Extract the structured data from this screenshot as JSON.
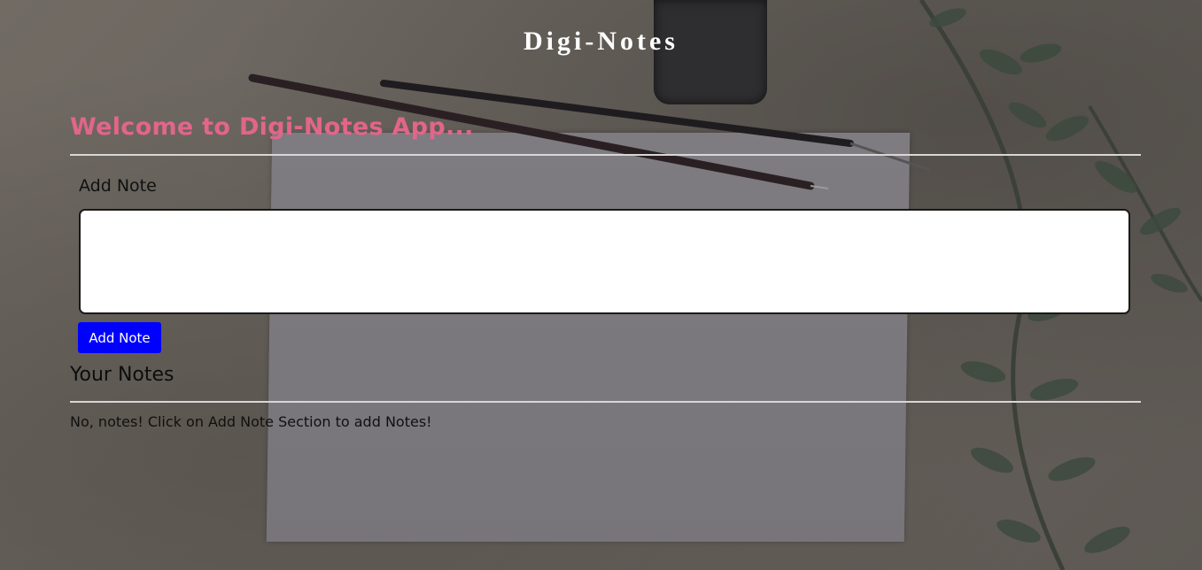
{
  "header": {
    "app_title": "Digi-Notes"
  },
  "main": {
    "welcome_text": "Welcome to Digi-Notes App...",
    "add_section": {
      "label": "Add Note",
      "textarea_value": "",
      "button_label": "Add Note"
    },
    "notes_section": {
      "heading": "Your Notes",
      "empty_message": "No, notes! Click on Add Note Section to add Notes!"
    }
  },
  "colors": {
    "welcome": "#e2658a",
    "button_bg": "#0000ff",
    "button_text": "#ffffff",
    "title": "#ffffff"
  }
}
